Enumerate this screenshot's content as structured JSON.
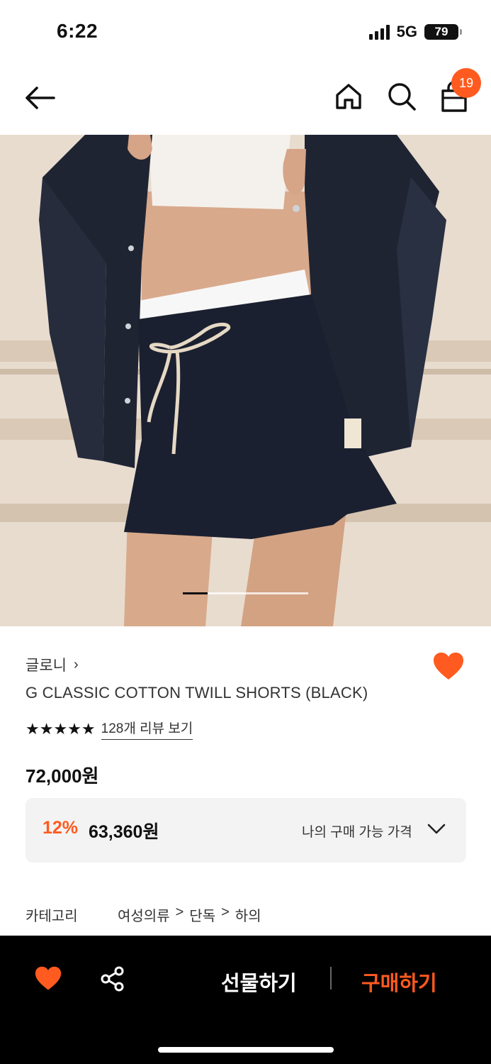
{
  "status_bar": {
    "time": "6:22",
    "network": "5G",
    "battery": "79"
  },
  "header": {
    "cart_count": "19",
    "icons": [
      "back-arrow-icon",
      "home-icon",
      "search-icon",
      "shopping-bag-icon"
    ]
  },
  "product": {
    "brand": "글로니",
    "title": "G CLASSIC COTTON TWILL SHORTS (BLACK)",
    "stars": "★★★★★",
    "review_link": "128개 리뷰 보기",
    "original_price": "72,000원",
    "discount_rate": "12%",
    "discount_price": "63,360원",
    "my_price_label": "나의 구매 가능 가격",
    "rating_value": 5,
    "image_index": 1
  },
  "category": {
    "label": "카테고리",
    "path": [
      "여성의류",
      "단독",
      "하의"
    ]
  },
  "bottom_bar": {
    "gift_label": "선물하기",
    "buy_label": "구매하기"
  },
  "colors": {
    "accent": "#ff5a1f",
    "bottom_bar_bg": "#000000",
    "discount_box_bg": "#f3f3f3"
  }
}
